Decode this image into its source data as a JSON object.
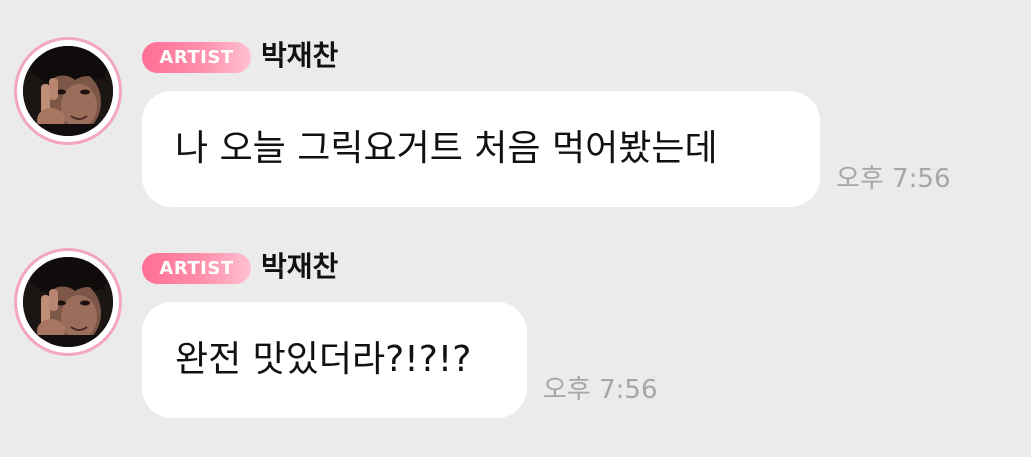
{
  "colors": {
    "background": "#ebebeb",
    "bubble": "#ffffff",
    "badge_start": "#ff6e95",
    "badge_end": "#ffc1d2",
    "avatar_ring": "#f3a6bf",
    "time_text": "#a6a6a6",
    "text": "#111111"
  },
  "messages": [
    {
      "badge": "ARTIST",
      "sender": "박재찬",
      "text": "나 오늘 그릭요거트 처음 먹어봤는데",
      "time": "오후 7:56",
      "avatar_icon": "profile-photo"
    },
    {
      "badge": "ARTIST",
      "sender": "박재찬",
      "text": "완전 맛있더라?!?!?",
      "time": "오후 7:56",
      "avatar_icon": "profile-photo"
    }
  ]
}
